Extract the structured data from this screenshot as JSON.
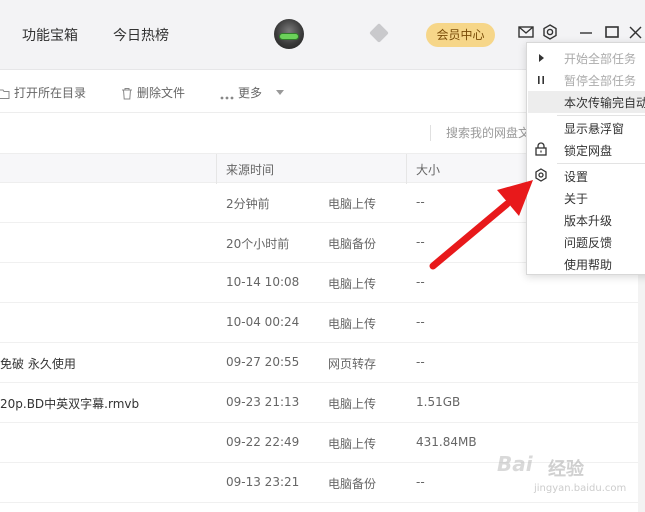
{
  "topbar": {
    "nav": [
      "功能宝箱",
      "今日热榜"
    ],
    "vip_label": "会员中心"
  },
  "toolbar": {
    "open_folder": "打开所在目录",
    "delete_file": "删除文件",
    "more": "更多"
  },
  "search": {
    "placeholder": "搜索我的网盘文"
  },
  "table": {
    "headers": {
      "time": "来源时间",
      "size": "大小"
    },
    "rows": [
      {
        "name": "",
        "time": "2分钟前",
        "source": "电脑上传",
        "size": "--"
      },
      {
        "name": "",
        "time": "20个小时前",
        "source": "电脑备份",
        "size": "--"
      },
      {
        "name": "",
        "time": "10-14 10:08",
        "source": "电脑上传",
        "size": "--"
      },
      {
        "name": "",
        "time": "10-04 00:24",
        "source": "电脑上传",
        "size": "--"
      },
      {
        "name": "免破 永久使用",
        "time": "09-27 20:55",
        "source": "网页转存",
        "size": "--"
      },
      {
        "name": "20p.BD中英双字幕.rmvb",
        "time": "09-23 21:13",
        "source": "电脑上传",
        "size": "1.51GB"
      },
      {
        "name": "",
        "time": "09-22 22:49",
        "source": "电脑上传",
        "size": "431.84MB"
      },
      {
        "name": "",
        "time": "09-13 23:21",
        "source": "电脑备份",
        "size": "--"
      }
    ]
  },
  "menu": {
    "start_all": "开始全部任务",
    "pause_all": "暂停全部任务",
    "after_transfer": "本次传输完自动",
    "show_float": "显示悬浮窗",
    "lock_disk": "锁定网盘",
    "settings": "设置",
    "about": "关于",
    "upgrade": "版本升级",
    "feedback": "问题反馈",
    "help": "使用帮助"
  },
  "watermark": {
    "brand": "Bai",
    "site": "经验",
    "url": "jingyan.baidu.com"
  },
  "colors": {
    "accent_arrow": "#e8191b",
    "vip_bg": "#f6d689",
    "topbar_bg": "#f3f3f5"
  }
}
